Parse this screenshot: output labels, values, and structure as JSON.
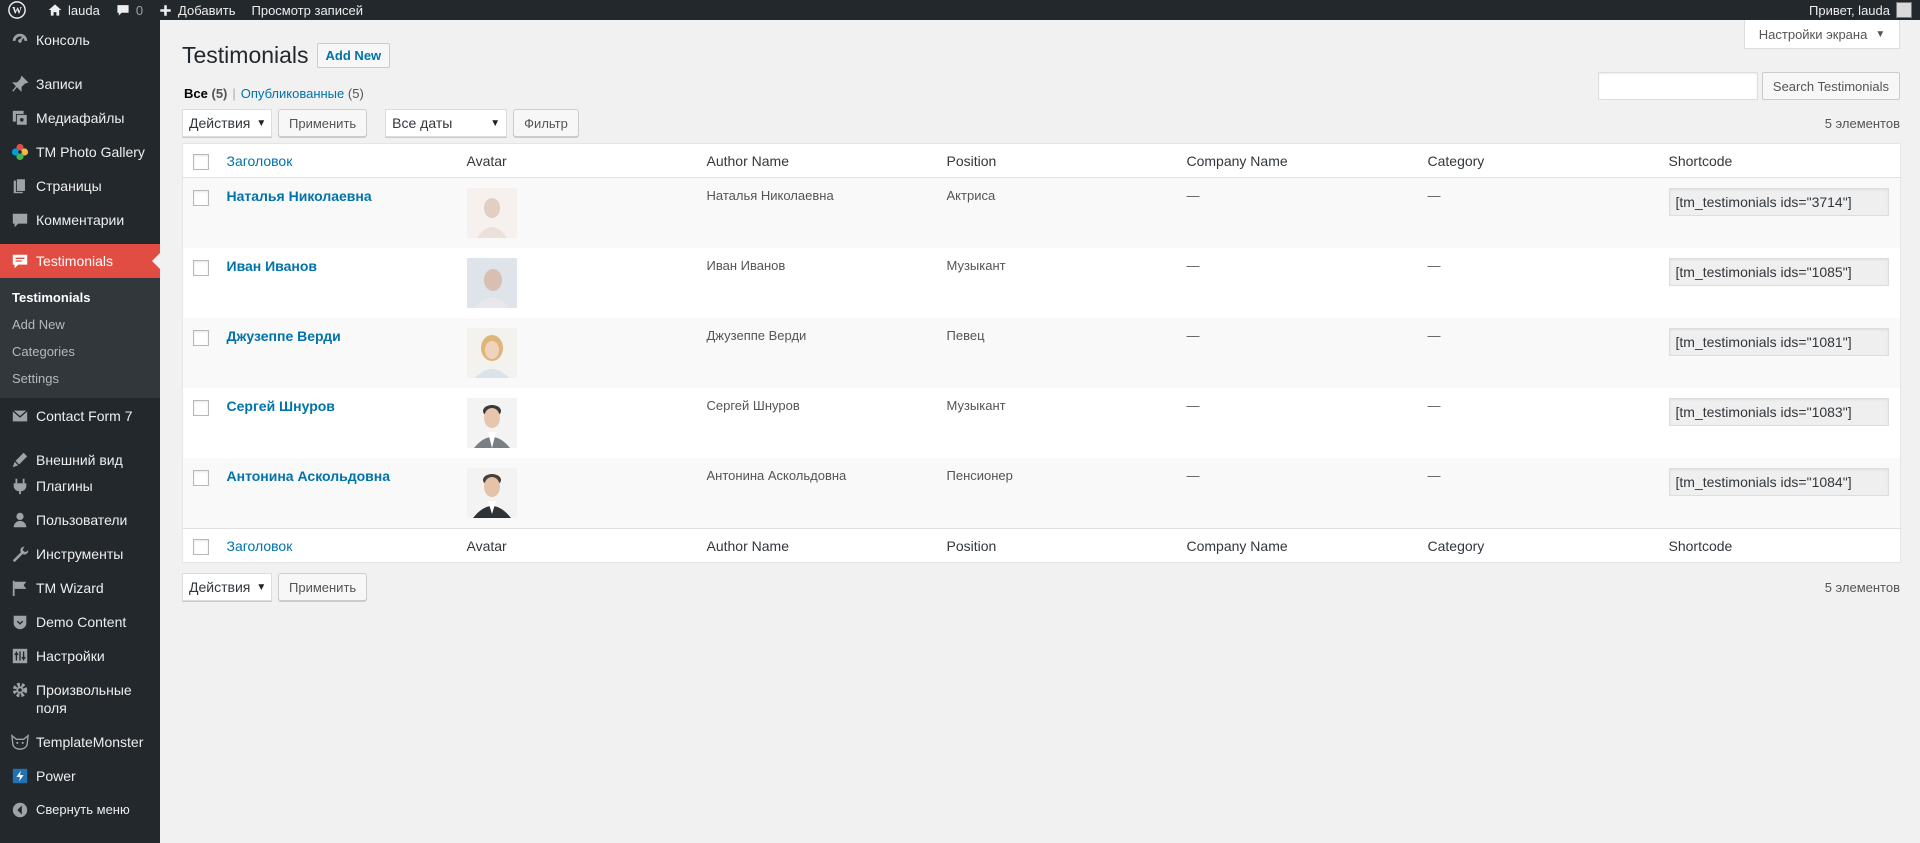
{
  "adminbar": {
    "site_name": "lauda",
    "comments_count": "0",
    "add_label": "Добавить",
    "view_posts_label": "Просмотр записей",
    "greeting": "Привет, lauda"
  },
  "sidebar": {
    "items": [
      {
        "label": "Консоль",
        "icon": "dashboard-icon"
      },
      {
        "label": "Записи",
        "icon": "pin-icon"
      },
      {
        "label": "Медиафайлы",
        "icon": "media-icon"
      },
      {
        "label": "TM Photo Gallery",
        "icon": "photo-gallery-icon"
      },
      {
        "label": "Страницы",
        "icon": "pages-icon"
      },
      {
        "label": "Комментарии",
        "icon": "comments-icon"
      },
      {
        "label": "Testimonials",
        "icon": "testimonials-icon"
      },
      {
        "label": "Contact Form 7",
        "icon": "mail-icon"
      },
      {
        "label": "Внешний вид",
        "icon": "appearance-icon"
      },
      {
        "label": "Плагины",
        "icon": "plugins-icon"
      },
      {
        "label": "Пользователи",
        "icon": "users-icon"
      },
      {
        "label": "Инструменты",
        "icon": "tools-icon"
      },
      {
        "label": "TM Wizard",
        "icon": "flag-icon"
      },
      {
        "label": "Demo Content",
        "icon": "shield-icon"
      },
      {
        "label": "Настройки",
        "icon": "settings-icon"
      },
      {
        "label": "Произвольные поля",
        "icon": "gear-icon"
      },
      {
        "label": "TemplateMonster",
        "icon": "cat-icon"
      },
      {
        "label": "Power",
        "icon": "power-icon"
      },
      {
        "label": "Свернуть меню",
        "icon": "collapse-icon"
      }
    ],
    "submenu": [
      "Testimonials",
      "Add New",
      "Categories",
      "Settings"
    ]
  },
  "screen_options": "Настройки экрана",
  "page": {
    "title": "Testimonials",
    "add_new": "Add New"
  },
  "views": {
    "all_label": "Все",
    "all_count": "(5)",
    "published_label": "Опубликованные",
    "published_count": "(5)"
  },
  "search": {
    "placeholder": "",
    "button": "Search Testimonials"
  },
  "tablenav": {
    "bulk_action": "Действия",
    "apply": "Применить",
    "dates": "Все даты",
    "filter": "Фильтр",
    "items_count": "5 элементов"
  },
  "columns": [
    "Заголовок",
    "Avatar",
    "Author Name",
    "Position",
    "Company Name",
    "Category",
    "Shortcode"
  ],
  "rows": [
    {
      "title": "Наталья Николаевна",
      "author": "Наталья Николаевна",
      "position": "Актриса",
      "company": "—",
      "category": "—",
      "shortcode": "[tm_testimonials ids=\"3714\"]",
      "avatar_color": "#d8c6bd"
    },
    {
      "title": "Иван Иванов",
      "author": "Иван Иванов",
      "position": "Музыкант",
      "company": "—",
      "category": "—",
      "shortcode": "[tm_testimonials ids=\"1085\"]",
      "avatar_color": "#c9b3a8"
    },
    {
      "title": "Джузеппе Верди",
      "author": "Джузеппе Верди",
      "position": "Певец",
      "company": "—",
      "category": "—",
      "shortcode": "[tm_testimonials ids=\"1081\"]",
      "avatar_color": "#e1b77e"
    },
    {
      "title": "Сергей Шнуров",
      "author": "Сергей Шнуров",
      "position": "Музыкант",
      "company": "—",
      "category": "—",
      "shortcode": "[tm_testimonials ids=\"1083\"]",
      "avatar_color": "#6b6b6b"
    },
    {
      "title": "Антонина Аскольдовна",
      "author": "Антонина Аскольдовна",
      "position": "Пенсионер",
      "company": "—",
      "category": "—",
      "shortcode": "[tm_testimonials ids=\"1084\"]",
      "avatar_color": "#4e4e4e"
    }
  ]
}
